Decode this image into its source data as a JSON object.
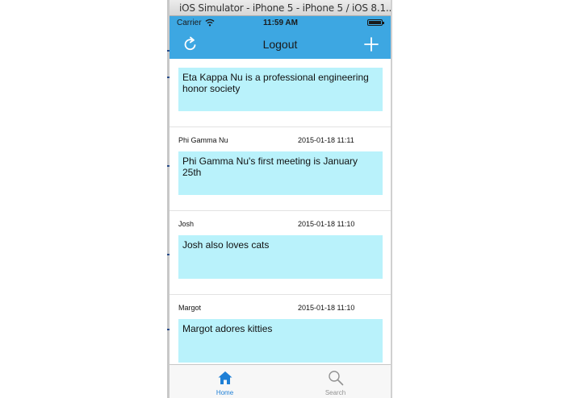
{
  "window": {
    "title": "iOS Simulator - iPhone 5 - iPhone 5 / iOS 8.1..."
  },
  "statusbar": {
    "carrier": "Carrier",
    "time": "11:59 AM"
  },
  "navbar": {
    "title": "Logout",
    "left_icon": "refresh-icon",
    "right_icon": "add-icon",
    "color": "#3da7e2"
  },
  "posts": [
    {
      "author": "",
      "date": "",
      "body": "Eta Kappa Nu is a professional engineering honor society"
    },
    {
      "author": "Phi Gamma Nu",
      "date": "2015-01-18 11:11",
      "body": "Phi Gamma Nu's first meeting is January 25th"
    },
    {
      "author": "Josh",
      "date": "2015-01-18 11:10",
      "body": "Josh also loves cats"
    },
    {
      "author": "Margot",
      "date": "2015-01-18 11:10",
      "body": "Margot adores kitties"
    }
  ],
  "tabs": [
    {
      "label": "Home",
      "icon": "home-icon",
      "selected": true
    },
    {
      "label": "Search",
      "icon": "search-icon",
      "selected": false
    }
  ],
  "colors": {
    "accent": "#3da7e2",
    "post_background": "#b9f2fb",
    "tab_selected": "#1e7fd6",
    "tab_unselected": "#929292"
  }
}
